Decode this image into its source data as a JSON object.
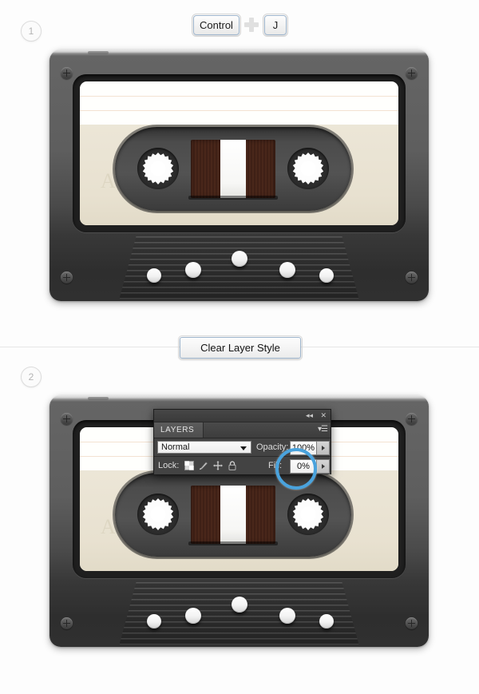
{
  "steps": [
    {
      "number": "1"
    },
    {
      "number": "2"
    }
  ],
  "shortcut": {
    "key1_label": "Control",
    "plus_icon": "plus-icon",
    "key2_label": "J"
  },
  "action_button": {
    "label": "Clear Layer Style"
  },
  "cassette": {
    "side_letter": "A",
    "body_color": "#4a4a4a",
    "label_color": "#ece6d7",
    "tape_color": "#3a1d14"
  },
  "layers_panel": {
    "titlebar": {
      "collapse_icon": "double-chevron-left-icon",
      "close_icon": "close-icon"
    },
    "tab_label": "LAYERS",
    "menu_icon": "panel-menu-icon",
    "blend_mode": {
      "value": "Normal"
    },
    "opacity": {
      "label": "Opacity:",
      "value": "100%"
    },
    "lock": {
      "label": "Lock:",
      "icons": [
        "lock-transparency-icon",
        "lock-image-icon",
        "lock-position-icon",
        "lock-all-icon"
      ]
    },
    "fill": {
      "label": "Fill:",
      "value": "0%"
    },
    "highlight_color": "#4aa3dd"
  }
}
